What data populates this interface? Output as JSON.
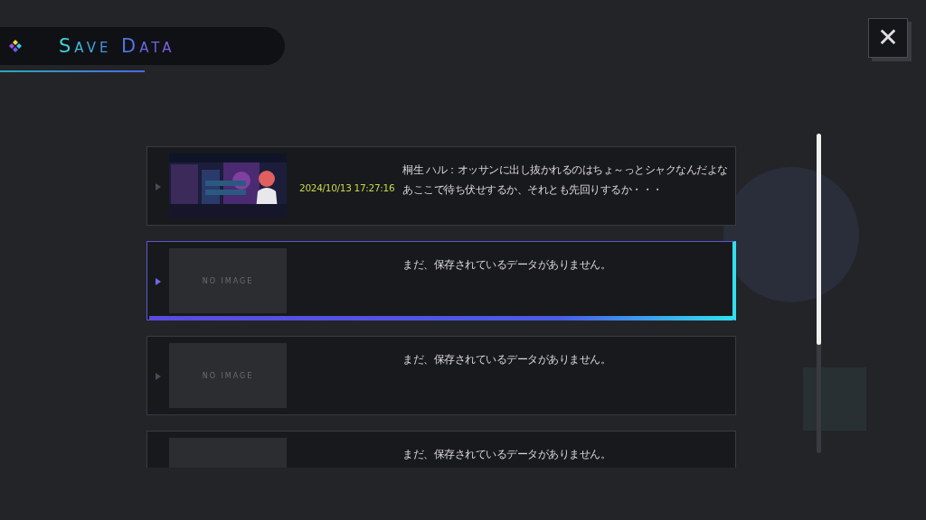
{
  "header": {
    "title": "Save Data"
  },
  "close_button": {
    "label": "✕"
  },
  "slots": [
    {
      "selected": false,
      "date": "2024/10/13 17:27:16",
      "lines": [
        "桐生 ハル：オッサンに出し抜かれるのはちょ～っとシャクなんだよな",
        "あここで待ち伏せするか、それとも先回りするか・・・"
      ]
    },
    {
      "selected": true,
      "thumbnail": {
        "kind": "empty",
        "label": "NO IMAGE"
      },
      "lines": [
        "まだ、保存されているデータがありません。"
      ]
    },
    {
      "selected": false,
      "thumbnail": {
        "kind": "empty",
        "label": "NO IMAGE"
      },
      "lines": [
        "まだ、保存されているデータがありません。"
      ]
    },
    {
      "selected": false,
      "thumbnail": {
        "kind": "empty"
      },
      "lines": [
        "まだ、保存されているデータがありません。"
      ]
    }
  ]
}
